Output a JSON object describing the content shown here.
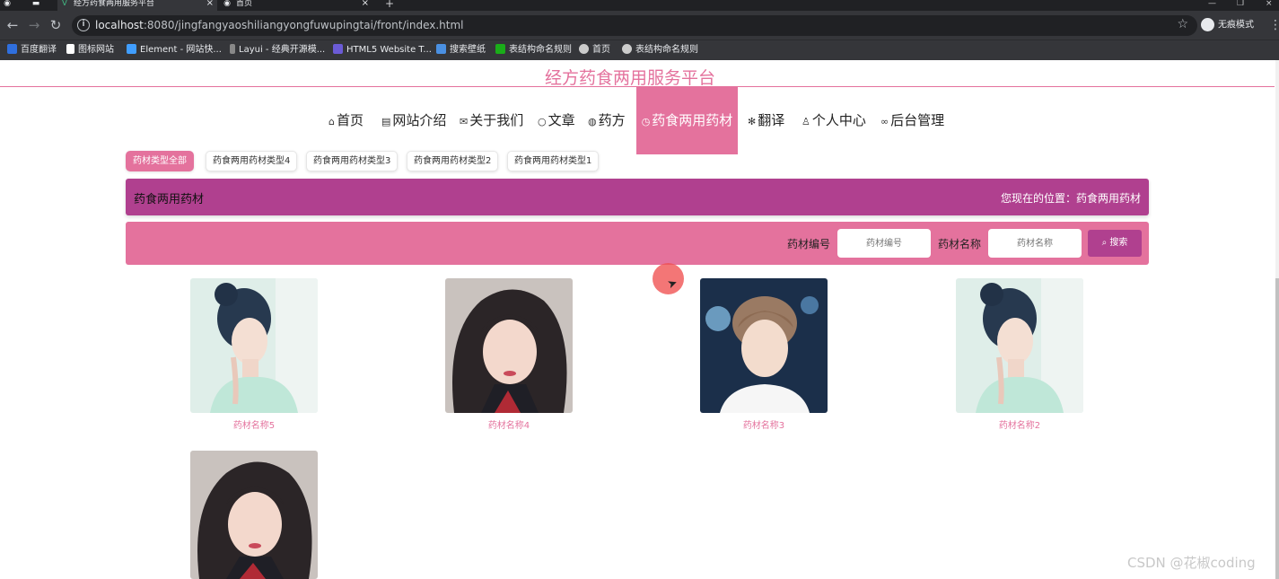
{
  "browser": {
    "tabs": [
      {
        "title": "",
        "icon": "chrome-icon"
      },
      {
        "title": "",
        "icon": "window-icon"
      },
      {
        "title": "经方药食两用服务平台",
        "icon": "vue-icon"
      },
      {
        "title": "首页",
        "icon": "chrome-icon"
      }
    ],
    "new_tab": "+",
    "url_host": "localhost",
    "url_rest": ":8080/jingfangyaoshiliangyongfuwupingtai/front/index.html",
    "incognito_label": "无痕模式",
    "bookmarks": [
      {
        "label": "百度翻译",
        "color": "#2f6fde"
      },
      {
        "label": "图标网站",
        "color": "#ffffff"
      },
      {
        "label": "Element - 网站快...",
        "color": "#409eff"
      },
      {
        "label": "Layui - 经典开源模...",
        "color": "#aaaaaa"
      },
      {
        "label": "HTML5 Website T...",
        "color": "#6b5bd6"
      },
      {
        "label": "搜索壁纸",
        "color": "#4a90e2"
      },
      {
        "label": "表结构命名规则",
        "color": "#1aad19"
      },
      {
        "label": "首页",
        "color": "#cccccc"
      },
      {
        "label": "表结构命名规则",
        "color": "#cccccc"
      }
    ]
  },
  "site": {
    "title": "经方药食两用服务平台",
    "accent": "#e4729d",
    "accent_dark": "#b0408f"
  },
  "nav": [
    {
      "icon": "⌂",
      "label": "首页",
      "active": false
    },
    {
      "icon": "▤",
      "label": "网站介绍",
      "active": false
    },
    {
      "icon": "✉",
      "label": "关于我们",
      "active": false
    },
    {
      "icon": "○",
      "label": "文章",
      "active": false
    },
    {
      "icon": "◍",
      "label": "药方",
      "active": false
    },
    {
      "icon": "◷",
      "label": "药食两用药材",
      "active": true
    },
    {
      "icon": "✻",
      "label": "翻译",
      "active": false
    },
    {
      "icon": "♙",
      "label": "个人中心",
      "active": false
    },
    {
      "icon": "∞",
      "label": "后台管理",
      "active": false
    }
  ],
  "type_tabs": [
    "药材类型全部",
    "药食两用药材类型4",
    "药食两用药材类型3",
    "药食两用药材类型2",
    "药食两用药材类型1"
  ],
  "breadcrumb": {
    "title": "药食两用药材",
    "location_prefix": "您现在的位置：",
    "location": "药食两用药材"
  },
  "search": {
    "code_label": "药材编号",
    "code_placeholder": "药材编号",
    "name_label": "药材名称",
    "name_placeholder": "药材名称",
    "button": "搜索"
  },
  "items": [
    {
      "name": "药材名称5",
      "photo": "woman-profile"
    },
    {
      "name": "药材名称4",
      "photo": "girl-portrait"
    },
    {
      "name": "药材名称3",
      "photo": "boy-portrait"
    },
    {
      "name": "药材名称2",
      "photo": "woman-profile"
    },
    {
      "name": "",
      "photo": "girl-portrait"
    }
  ],
  "watermark": "CSDN @花椒coding"
}
